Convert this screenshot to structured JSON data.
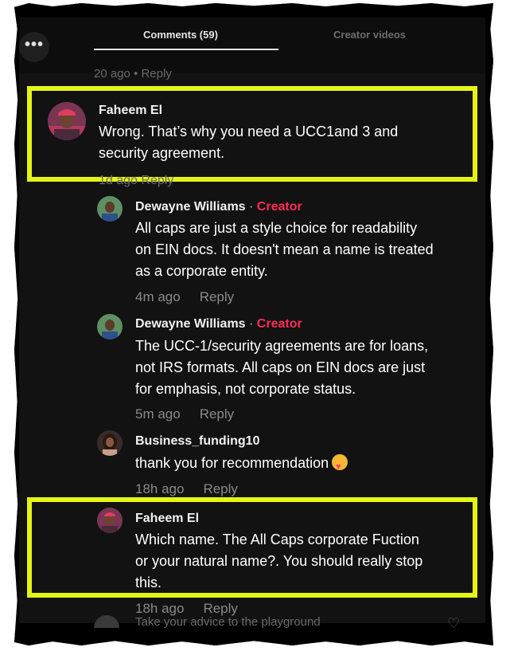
{
  "tabs": {
    "comments": "Comments (59)",
    "creator_videos": "Creator videos"
  },
  "more_button": "•••",
  "faded_top": "20 ago • Reply",
  "comments": [
    {
      "name": "Faheem El",
      "text_line1": "Wrong. That’s why you need a UCC1and 3 and",
      "text_line2": "security agreement.",
      "faded_meta": "1d ago   Reply"
    },
    {
      "name": "Dewayne Williams",
      "separator": " · ",
      "tag": "Creator",
      "text_line1": "All caps are just a style choice for readability",
      "text_line2": "on EIN docs. It doesn't mean a name is treated",
      "text_line3": "as a corporate entity.",
      "time": "4m ago",
      "reply": "Reply"
    },
    {
      "name": "Dewayne Williams",
      "separator": " · ",
      "tag": "Creator",
      "text_line1": "The UCC-1/security agreements are for loans,",
      "text_line2": "not IRS formats. All caps on EIN docs are just",
      "text_line3": "for emphasis, not corporate status.",
      "time": "5m ago",
      "reply": "Reply"
    },
    {
      "name": "Business_funding10",
      "text_line1": "thank you for recommendation",
      "time": "18h ago",
      "reply": "Reply"
    },
    {
      "name": "Faheem El",
      "text_line1": "Which name. The All Caps corporate Fuction",
      "text_line2": "or your natural name?. You should really stop",
      "text_line3": "this.",
      "time": "18h ago",
      "reply": "Reply"
    }
  ],
  "faded_bottom": "Take your advice to the playground",
  "colors": {
    "highlight": "#e4f516",
    "creator_tag": "#fe2c55",
    "background": "#121212"
  }
}
